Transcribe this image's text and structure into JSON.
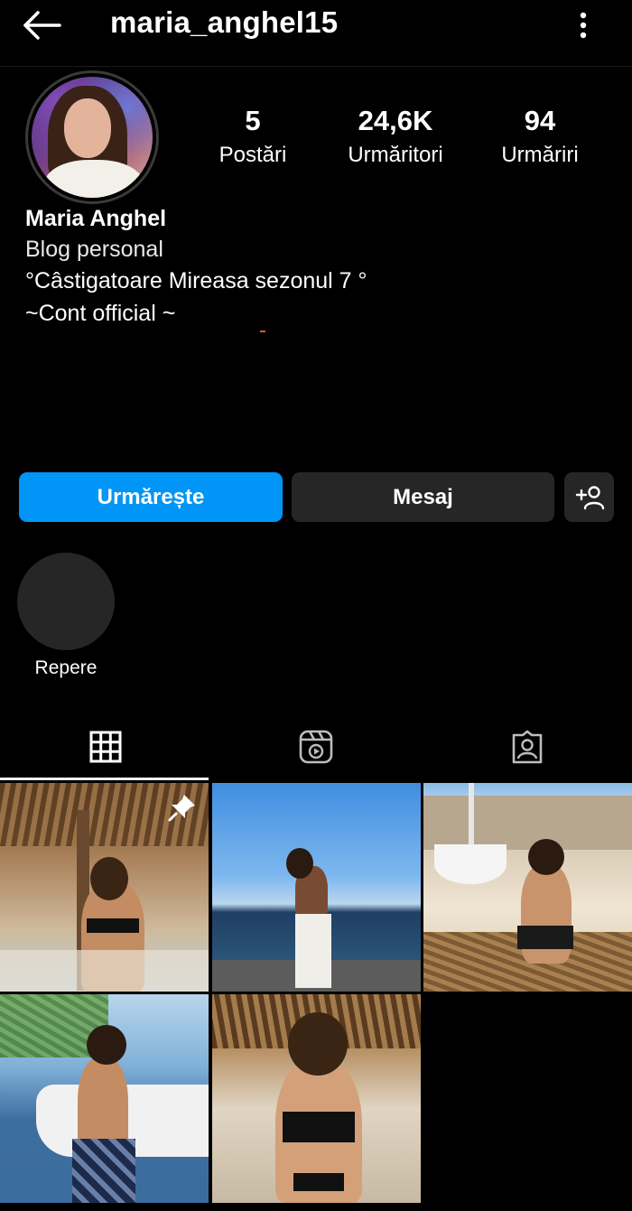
{
  "header": {
    "username": "maria_anghel15",
    "back_icon": "arrow-left-icon",
    "menu_icon": "more-vertical-icon"
  },
  "stats": [
    {
      "value": "5",
      "label": "Postări"
    },
    {
      "value": "24,6K",
      "label": "Urmăritori"
    },
    {
      "value": "94",
      "label": "Urmăriri"
    }
  ],
  "bio": {
    "name": "Maria Anghel",
    "category": "Blog personal",
    "line1": "°Câstigatoare Mireasa sezonul 7 °",
    "line2": "~Cont official ~"
  },
  "actions": {
    "follow": "Urmărește",
    "message": "Mesaj",
    "add_icon": "add-person-icon"
  },
  "highlights": [
    {
      "label": "Repere"
    }
  ],
  "tabs": [
    {
      "icon": "grid-icon",
      "active": true
    },
    {
      "icon": "reels-icon",
      "active": false
    },
    {
      "icon": "tagged-icon",
      "active": false
    }
  ],
  "posts": [
    {
      "pinned": true
    },
    {
      "pinned": false
    },
    {
      "pinned": false
    },
    {
      "pinned": false
    },
    {
      "pinned": false
    }
  ],
  "colors": {
    "background": "#000000",
    "primary_button": "#0095f6",
    "secondary_button": "#262626",
    "text": "#ffffff"
  }
}
